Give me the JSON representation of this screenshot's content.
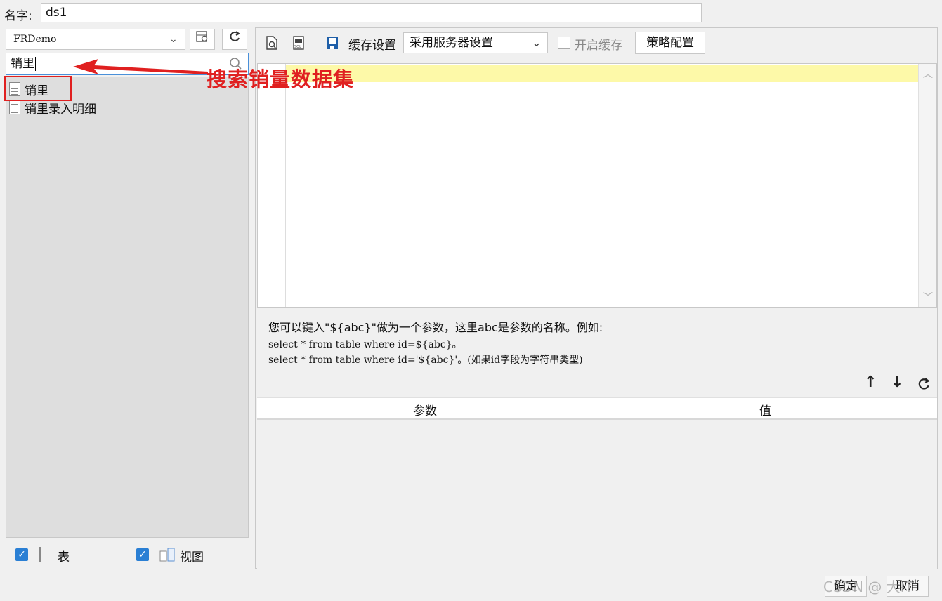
{
  "name_row": {
    "label": "名字:",
    "value": "ds1"
  },
  "left": {
    "connection": "FRDemo",
    "search_value": "销里",
    "tree_items": [
      "销里",
      "销里录入明细"
    ],
    "checks": {
      "table_label": "表",
      "view_label": "视图"
    }
  },
  "annotation": {
    "text": "搜索销量数据集",
    "color": "#e02020"
  },
  "right": {
    "toolbar": {
      "cache_label": "缓存设置",
      "cache_select_value": "采用服务器设置",
      "enable_cache_label": "开启缓存",
      "policy_button": "策略配置"
    },
    "hint": {
      "line1": "您可以键入\"${abc}\"做为一个参数，这里abc是参数的名称。例如:",
      "line2": "select * from table where id=${abc}。",
      "line3": "select * from table where id='${abc}'。(如果id字段为字符串类型)"
    },
    "param_table": {
      "col_param": "参数",
      "col_value": "值"
    }
  },
  "footer": {
    "ok": "确定",
    "cancel": "取消",
    "watermark": "CSDN @ 大IT"
  }
}
